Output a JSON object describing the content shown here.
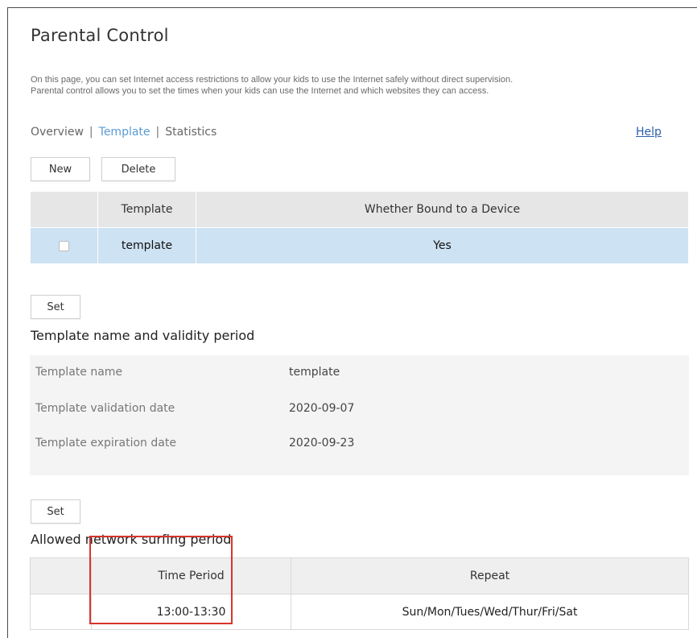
{
  "page": {
    "title": "Parental Control",
    "description_line1": "On this page, you can set Internet access restrictions to allow your kids to use the Internet safely without direct supervision.",
    "description_line2": "Parental control allows you to set the times when your kids can use the Internet and which websites they can access."
  },
  "nav": {
    "overview": "Overview",
    "template": "Template",
    "statistics": "Statistics",
    "separator": "|",
    "help": "Help",
    "active_color": "#5b9bd5"
  },
  "toolbar": {
    "new_label": "New",
    "delete_label": "Delete"
  },
  "template_table": {
    "headers": [
      "",
      "Template",
      "Whether Bound to a Device"
    ],
    "rows": [
      {
        "checked": false,
        "template": "template",
        "bound": "Yes"
      }
    ],
    "selected_row_color": "#cde2f3"
  },
  "validity": {
    "set_label": "Set",
    "section_title": "Template name and validity period",
    "fields": [
      {
        "label": "Template name",
        "value": "template"
      },
      {
        "label": "Template validation date",
        "value": "2020-09-07"
      },
      {
        "label": "Template expiration date",
        "value": "2020-09-23"
      }
    ]
  },
  "surfing": {
    "set_label": "Set",
    "section_title": "Allowed network surfing period",
    "headers": [
      "",
      "Time Period",
      "Repeat"
    ],
    "rows": [
      {
        "time_period": "13:00-13:30",
        "repeat": "Sun/Mon/Tues/Wed/Thur/Fri/Sat"
      }
    ],
    "highlight_color": "#d9342b"
  }
}
